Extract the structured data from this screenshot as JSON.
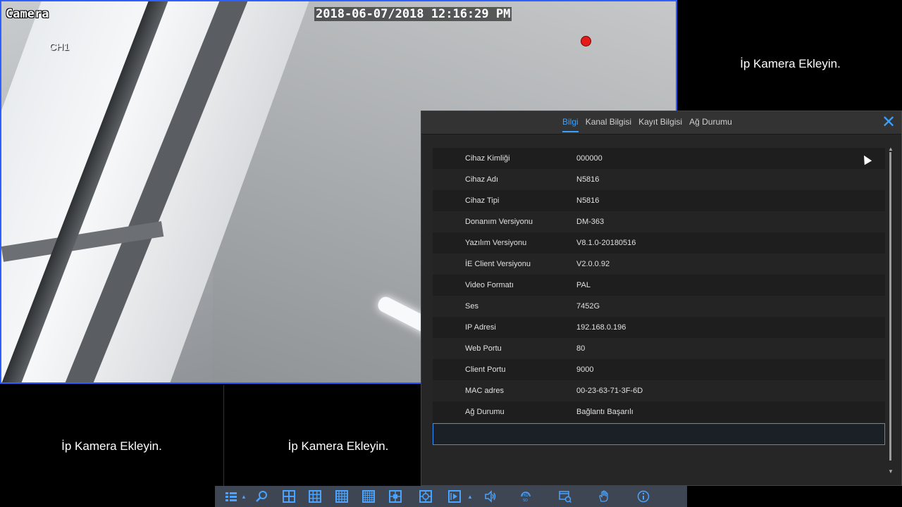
{
  "osd": {
    "camera_label": "Camera",
    "channel_label": "CH1",
    "datetime": "2018-06-07/2018 12:16:29 PM"
  },
  "empty_channel_text": "İp Kamera Ekleyin.",
  "panel": {
    "tabs": [
      {
        "label": "Bilgi",
        "active": true
      },
      {
        "label": "Kanal Bilgisi",
        "active": false
      },
      {
        "label": "Kayıt Bilgisi",
        "active": false
      },
      {
        "label": "Ağ Durumu",
        "active": false
      }
    ],
    "rows": [
      {
        "key": "Cihaz Kimliği",
        "value": "000000"
      },
      {
        "key": "Cihaz Adı",
        "value": "N5816"
      },
      {
        "key": "Cihaz Tipi",
        "value": "N5816"
      },
      {
        "key": "Donanım Versiyonu",
        "value": "DM-363"
      },
      {
        "key": "Yazılım Versiyonu",
        "value": "V8.1.0-20180516"
      },
      {
        "key": "İE Client Versiyonu",
        "value": "V2.0.0.92"
      },
      {
        "key": "Video Formatı",
        "value": "PAL"
      },
      {
        "key": "Ses",
        "value": "7452G"
      },
      {
        "key": "IP Adresi",
        "value": "192.168.0.196"
      },
      {
        "key": "Web Portu",
        "value": "80"
      },
      {
        "key": "Client Portu",
        "value": "9000"
      },
      {
        "key": "MAC adres",
        "value": "00-23-63-71-3F-6D"
      },
      {
        "key": "Ağ Durumu",
        "value": "Bağlantı Başarılı"
      }
    ]
  },
  "colors": {
    "accent": "#3aa0ff",
    "record": "#e41b1b",
    "selected_channel_border": "#2f5fff"
  },
  "toolbar": {
    "icons": [
      "main-menu-icon",
      "search-icon",
      "layout-1-icon",
      "layout-4-icon",
      "layout-9-icon",
      "layout-16-icon",
      "layout-custom-icon",
      "pip-icon",
      "sequence-icon",
      "volume-icon",
      "hd-icon",
      "record-search-icon",
      "ptz-hand-icon",
      "info-icon"
    ]
  }
}
